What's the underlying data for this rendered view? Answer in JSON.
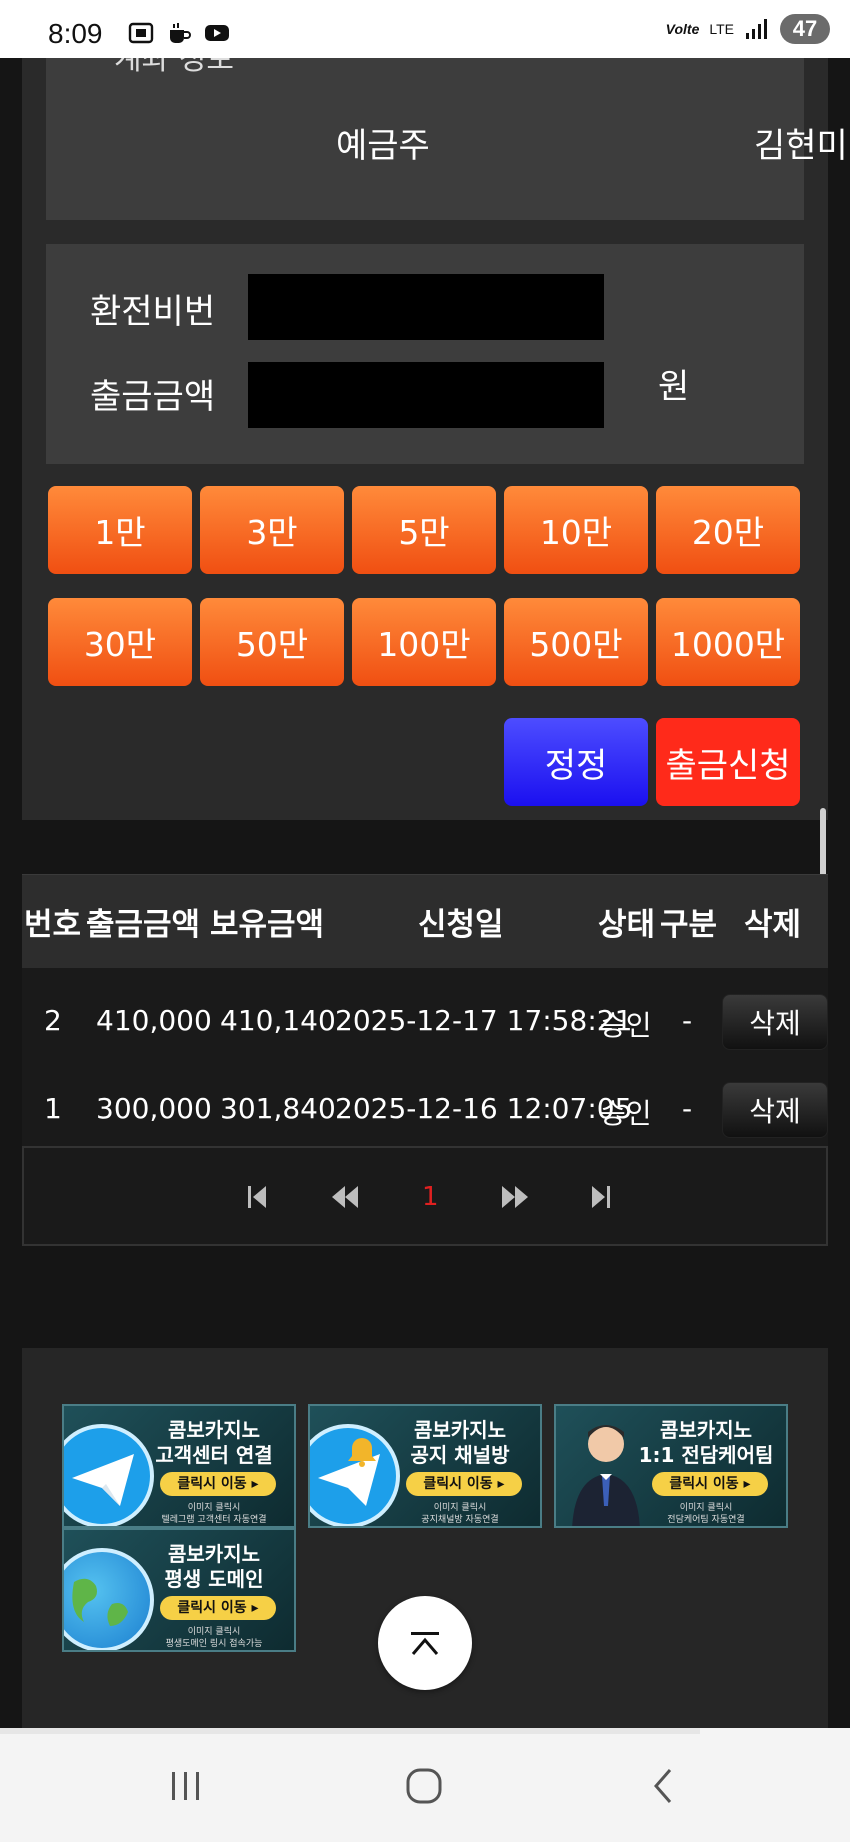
{
  "status_bar": {
    "time": "8:09",
    "network": "LTE",
    "volte": "Volte",
    "battery": "47"
  },
  "account": {
    "label": "계좌 정보",
    "bank": "예금주",
    "holder": "김현미"
  },
  "form": {
    "password_label": "환전비번",
    "amount_label": "출금금액",
    "currency_unit": "원",
    "password_value": "",
    "amount_value": ""
  },
  "amount_buttons": [
    "1만",
    "3만",
    "5만",
    "10만",
    "20만",
    "30만",
    "50만",
    "100만",
    "500만",
    "1000만"
  ],
  "actions": {
    "reset": "정정",
    "submit": "출금신청"
  },
  "table": {
    "headers": {
      "no": "번호",
      "withdraw": "출금금액",
      "balance": "보유금액",
      "date": "신청일",
      "status": "상태",
      "type": "구분",
      "delete": "삭제"
    },
    "rows": [
      {
        "no": "2",
        "withdraw": "410,000",
        "balance": "410,140",
        "date": "2025-12-17 17:58:21",
        "status": "승인",
        "type": "-",
        "delete": "삭제"
      },
      {
        "no": "1",
        "withdraw": "300,000",
        "balance": "301,840",
        "date": "2025-12-16 12:07:05",
        "status": "승인",
        "type": "-",
        "delete": "삭제"
      }
    ]
  },
  "pagination": {
    "current": "1"
  },
  "banners": [
    {
      "title1": "콤보카지노",
      "title2": "고객센터 연결",
      "button": "클릭시 이동 ▸",
      "small1": "이미지 클릭시",
      "small2": "텔레그램 고객센터 자동연결"
    },
    {
      "title1": "콤보카지노",
      "title2": "공지 채널방",
      "button": "클릭시 이동 ▸",
      "small1": "이미지 클릭시",
      "small2": "공지채널방 자동연결"
    },
    {
      "title1": "콤보카지노",
      "title2": "1:1 전담케어팀",
      "button": "클릭시 이동 ▸",
      "small1": "이미지 클릭시",
      "small2": "전담케어팀 자동연결"
    },
    {
      "title1": "콤보카지노",
      "title2": "평생 도메인",
      "button": "클릭시 이동 ▸",
      "small1": "이미지 클릭시",
      "small2": "평생도메인 링시 접속가능"
    }
  ]
}
